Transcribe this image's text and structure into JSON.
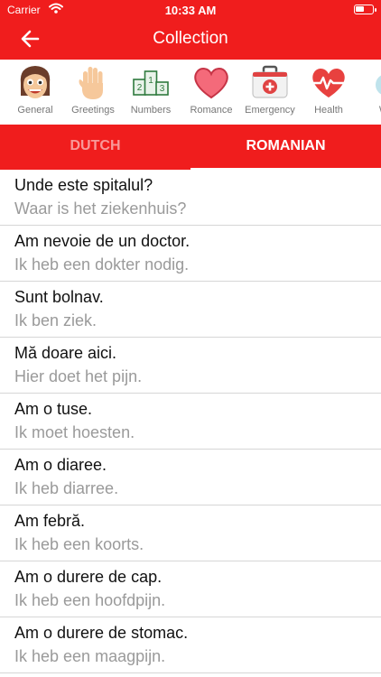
{
  "status": {
    "carrier": "Carrier",
    "time": "10:33 AM"
  },
  "header": {
    "title": "Collection"
  },
  "categories": [
    {
      "label": "General",
      "icon": "face-icon"
    },
    {
      "label": "Greetings",
      "icon": "hand-icon"
    },
    {
      "label": "Numbers",
      "icon": "podium-icon",
      "digits": [
        "2",
        "1",
        "3"
      ]
    },
    {
      "label": "Romance",
      "icon": "heart-icon"
    },
    {
      "label": "Emergency",
      "icon": "first-aid-icon"
    },
    {
      "label": "Health",
      "icon": "heartbeat-icon"
    },
    {
      "label": "We",
      "icon": "weather-icon"
    }
  ],
  "languages": {
    "left": "DUTCH",
    "right": "ROMANIAN",
    "active": "ROMANIAN"
  },
  "phrases": [
    {
      "phrase": "Unde este spitalul?",
      "translation": "Waar is het ziekenhuis?"
    },
    {
      "phrase": "Am nevoie de un doctor.",
      "translation": "Ik heb een dokter nodig."
    },
    {
      "phrase": "Sunt bolnav.",
      "translation": "Ik ben ziek."
    },
    {
      "phrase": "Mă doare aici.",
      "translation": "Hier doet het pijn."
    },
    {
      "phrase": "Am o tuse.",
      "translation": "Ik moet hoesten."
    },
    {
      "phrase": "Am o diaree.",
      "translation": "Ik heb diarree."
    },
    {
      "phrase": "Am febră.",
      "translation": "Ik heb een koorts."
    },
    {
      "phrase": "Am o durere de cap.",
      "translation": "Ik heb een hoofdpijn."
    },
    {
      "phrase": "Am o durere de stomac.",
      "translation": "Ik heb een maagpijn."
    }
  ],
  "colors": {
    "accent": "#f01d1d",
    "secondary_text": "#9a9a9a"
  }
}
